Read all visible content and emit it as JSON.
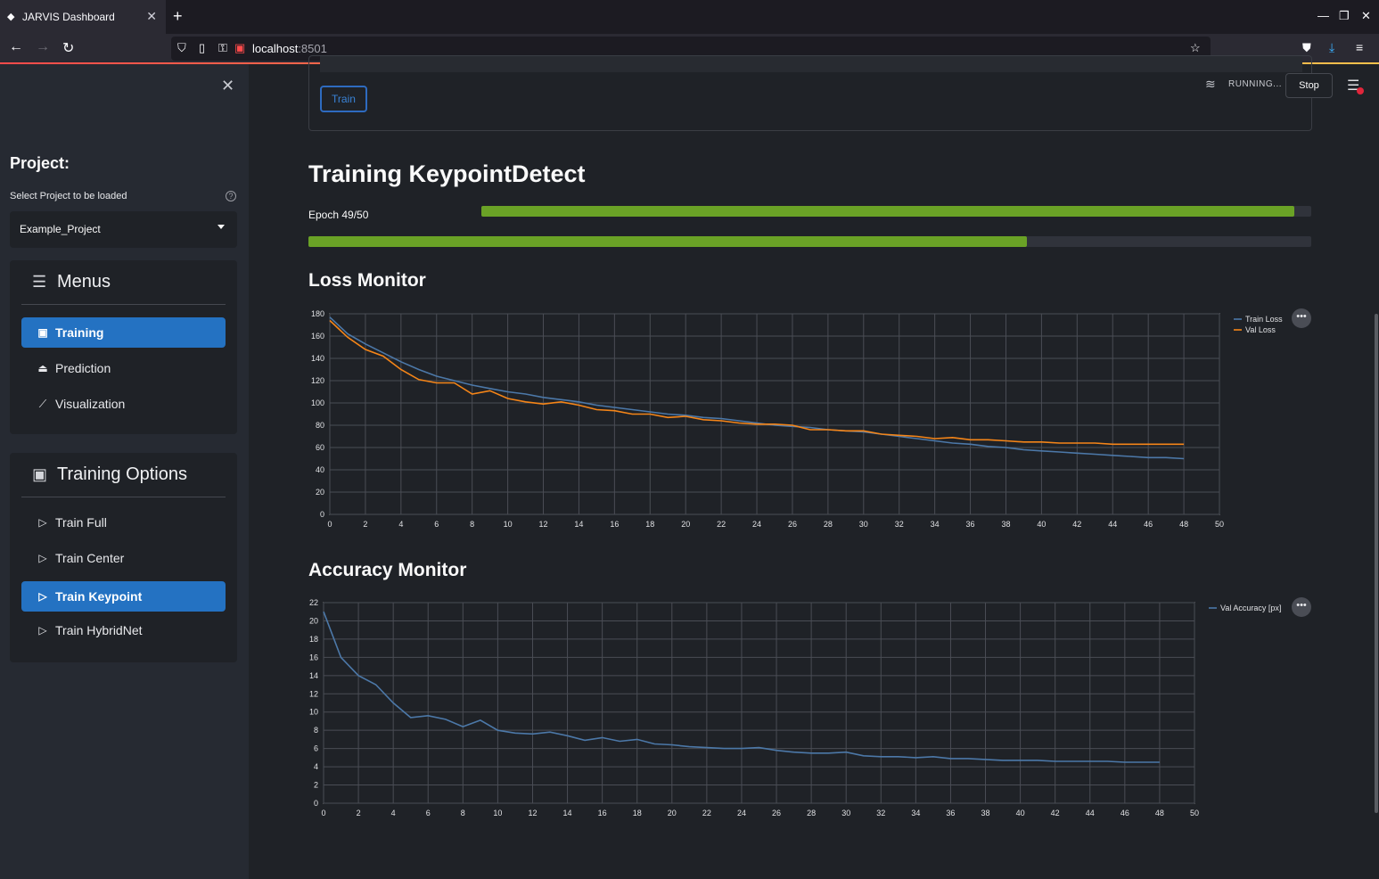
{
  "browser": {
    "tab_title": "JARVIS Dashboard",
    "url_host": "localhost",
    "url_port": ":8501"
  },
  "sidebar": {
    "project_title": "Project:",
    "select_label": "Select Project to be loaded",
    "selected_project": "Example_Project",
    "menus_title": "Menus",
    "menu_items": [
      {
        "label": "Training",
        "icon": "training-icon",
        "active": true
      },
      {
        "label": "Prediction",
        "icon": "prediction-icon",
        "active": false
      },
      {
        "label": "Visualization",
        "icon": "chart-line-icon",
        "active": false
      }
    ],
    "training_options_title": "Training Options",
    "training_items": [
      {
        "label": "Train Full",
        "active": false
      },
      {
        "label": "Train Center",
        "active": false
      },
      {
        "label": "Train Keypoint",
        "active": true
      },
      {
        "label": "Train HybridNet",
        "active": false
      }
    ]
  },
  "header": {
    "running_label": "RUNNING...",
    "stop_label": "Stop"
  },
  "form": {
    "train_label": "Train"
  },
  "main": {
    "title": "Training KeypointDetect",
    "epoch_label": "Epoch 49/50",
    "epoch_progress": 0.98,
    "overall_progress": 0.716,
    "loss_title": "Loss Monitor",
    "accuracy_title": "Accuracy Monitor"
  },
  "colors": {
    "accent": "#2472c2",
    "progress": "#6aa226",
    "train_loss": "#4c78a8",
    "val_loss": "#f58518",
    "running_red": "#ff4b4b"
  },
  "chart_data": [
    {
      "type": "line",
      "title": "Loss Monitor",
      "xlim": [
        0,
        50
      ],
      "ylim": [
        0,
        180
      ],
      "xticks": [
        0,
        2,
        4,
        6,
        8,
        10,
        12,
        14,
        16,
        18,
        20,
        22,
        24,
        26,
        28,
        30,
        32,
        34,
        36,
        38,
        40,
        42,
        44,
        46,
        48,
        50
      ],
      "yticks": [
        0,
        20,
        40,
        60,
        80,
        100,
        120,
        140,
        160,
        180
      ],
      "legend": "top-right",
      "series": [
        {
          "name": "Train Loss",
          "color": "#4c78a8",
          "x": [
            0,
            1,
            2,
            3,
            4,
            5,
            6,
            7,
            8,
            9,
            10,
            11,
            12,
            13,
            14,
            15,
            16,
            17,
            18,
            19,
            20,
            21,
            22,
            23,
            24,
            25,
            26,
            27,
            28,
            29,
            30,
            31,
            32,
            33,
            34,
            35,
            36,
            37,
            38,
            39,
            40,
            41,
            42,
            43,
            44,
            45,
            46,
            47,
            48
          ],
          "y": [
            177,
            162,
            153,
            145,
            137,
            130,
            124,
            120,
            116,
            113,
            110,
            108,
            105,
            103,
            101,
            98,
            96,
            94,
            92,
            90,
            89,
            87,
            86,
            84,
            82,
            80,
            79,
            78,
            76,
            75,
            74,
            72,
            70,
            68,
            66,
            64,
            63,
            61,
            60,
            58,
            57,
            56,
            55,
            54,
            53,
            52,
            51,
            51,
            50
          ]
        },
        {
          "name": "Val Loss",
          "color": "#f58518",
          "x": [
            0,
            1,
            2,
            3,
            4,
            5,
            6,
            7,
            8,
            9,
            10,
            11,
            12,
            13,
            14,
            15,
            16,
            17,
            18,
            19,
            20,
            21,
            22,
            23,
            24,
            25,
            26,
            27,
            28,
            29,
            30,
            31,
            32,
            33,
            34,
            35,
            36,
            37,
            38,
            39,
            40,
            41,
            42,
            43,
            44,
            45,
            46,
            47,
            48
          ],
          "y": [
            174,
            159,
            148,
            142,
            130,
            121,
            118,
            118,
            108,
            111,
            104,
            101,
            99,
            101,
            98,
            94,
            93,
            90,
            90,
            87,
            88,
            85,
            84,
            82,
            81,
            81,
            80,
            76,
            76,
            75,
            75,
            72,
            71,
            70,
            68,
            69,
            67,
            67,
            66,
            65,
            65,
            64,
            64,
            64,
            63,
            63,
            63,
            63,
            63
          ]
        }
      ]
    },
    {
      "type": "line",
      "title": "Accuracy Monitor",
      "xlim": [
        0,
        50
      ],
      "ylim": [
        0,
        22
      ],
      "xticks": [
        0,
        2,
        4,
        6,
        8,
        10,
        12,
        14,
        16,
        18,
        20,
        22,
        24,
        26,
        28,
        30,
        32,
        34,
        36,
        38,
        40,
        42,
        44,
        46,
        48,
        50
      ],
      "yticks": [
        0,
        2,
        4,
        6,
        8,
        10,
        12,
        14,
        16,
        18,
        20,
        22
      ],
      "legend": "top-right",
      "series": [
        {
          "name": "Val Accuracy [px]",
          "color": "#4c78a8",
          "x": [
            0,
            1,
            2,
            3,
            4,
            5,
            6,
            7,
            8,
            9,
            10,
            11,
            12,
            13,
            14,
            15,
            16,
            17,
            18,
            19,
            20,
            21,
            22,
            23,
            24,
            25,
            26,
            27,
            28,
            29,
            30,
            31,
            32,
            33,
            34,
            35,
            36,
            37,
            38,
            39,
            40,
            41,
            42,
            43,
            44,
            45,
            46,
            47,
            48
          ],
          "y": [
            21,
            16,
            14,
            13,
            11,
            9.4,
            9.6,
            9.2,
            8.4,
            9.1,
            8,
            7.7,
            7.6,
            7.8,
            7.4,
            6.9,
            7.2,
            6.8,
            7,
            6.5,
            6.4,
            6.2,
            6.1,
            6,
            6,
            6.1,
            5.8,
            5.6,
            5.5,
            5.5,
            5.6,
            5.2,
            5.1,
            5.1,
            5,
            5.1,
            4.9,
            4.9,
            4.8,
            4.7,
            4.7,
            4.7,
            4.6,
            4.6,
            4.6,
            4.6,
            4.5,
            4.5,
            4.5
          ]
        }
      ]
    }
  ]
}
